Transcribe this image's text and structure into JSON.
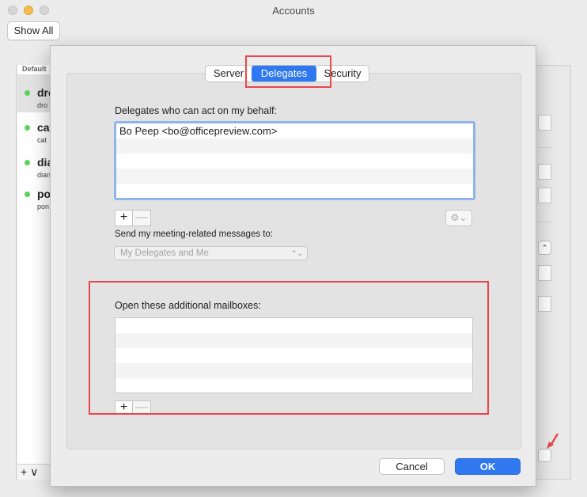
{
  "window": {
    "title": "Accounts"
  },
  "toolbar": {
    "show_all_label": "Show All"
  },
  "accounts": {
    "header": "Default",
    "items": [
      {
        "name": "dro",
        "sub": "dro"
      },
      {
        "name": "cat",
        "sub": "cat"
      },
      {
        "name": "dia",
        "sub": "dian"
      },
      {
        "name": "po",
        "sub": "pon"
      }
    ],
    "footer": "+ ∨"
  },
  "tabs": {
    "items": [
      {
        "label": "Server"
      },
      {
        "label": "Delegates"
      },
      {
        "label": "Security"
      }
    ],
    "selected": "Delegates"
  },
  "delegates": {
    "title": "Delegates who can act on my behalf:",
    "list": [
      "Bo Peep <bo@officepreview.com>"
    ],
    "add_label": "+",
    "remove_label": "—",
    "gear_label": "⚙⌄"
  },
  "meeting": {
    "label": "Send my meeting-related messages to:",
    "value": "My Delegates and Me"
  },
  "mailboxes": {
    "title": "Open these additional mailboxes:",
    "list": [],
    "add_label": "+",
    "remove_label": "—"
  },
  "buttons": {
    "cancel": "Cancel",
    "ok": "OK"
  },
  "colors": {
    "accent": "#2f78f0",
    "annotation": "#e8474b",
    "status_online": "#5bd25b"
  }
}
